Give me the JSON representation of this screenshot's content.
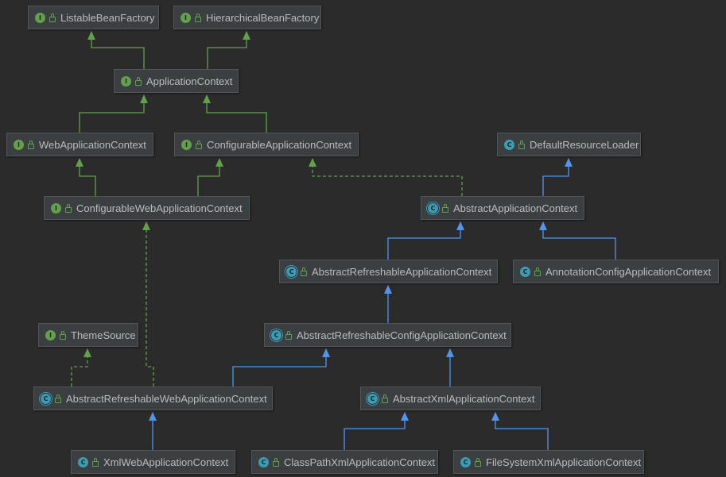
{
  "nodes": {
    "listable_bean_factory": {
      "label": "ListableBeanFactory",
      "kind": "interface",
      "badge": "I"
    },
    "hierarchical_bean_factory": {
      "label": "HierarchicalBeanFactory",
      "kind": "interface",
      "badge": "I"
    },
    "application_context": {
      "label": "ApplicationContext",
      "kind": "interface",
      "badge": "I"
    },
    "web_application_context": {
      "label": "WebApplicationContext",
      "kind": "interface",
      "badge": "I"
    },
    "configurable_application_context": {
      "label": "ConfigurableApplicationContext",
      "kind": "interface",
      "badge": "I"
    },
    "default_resource_loader": {
      "label": "DefaultResourceLoader",
      "kind": "class",
      "badge": "C"
    },
    "configurable_web_application_context": {
      "label": "ConfigurableWebApplicationContext",
      "kind": "interface",
      "badge": "I"
    },
    "abstract_application_context": {
      "label": "AbstractApplicationContext",
      "kind": "abstract",
      "badge": "C"
    },
    "abstract_refreshable_application_context": {
      "label": "AbstractRefreshableApplicationContext",
      "kind": "abstract",
      "badge": "C"
    },
    "annotation_config_application_context": {
      "label": "AnnotationConfigApplicationContext",
      "kind": "class",
      "badge": "C"
    },
    "theme_source": {
      "label": "ThemeSource",
      "kind": "interface",
      "badge": "I"
    },
    "abstract_refreshable_config_application_context": {
      "label": "AbstractRefreshableConfigApplicationContext",
      "kind": "abstract",
      "badge": "C"
    },
    "abstract_refreshable_web_application_context": {
      "label": "AbstractRefreshableWebApplicationContext",
      "kind": "abstract",
      "badge": "C"
    },
    "abstract_xml_application_context": {
      "label": "AbstractXmlApplicationContext",
      "kind": "abstract",
      "badge": "C"
    },
    "xml_web_application_context": {
      "label": "XmlWebApplicationContext",
      "kind": "class",
      "badge": "C"
    },
    "class_path_xml_application_context": {
      "label": "ClassPathXmlApplicationContext",
      "kind": "class",
      "badge": "C"
    },
    "file_system_xml_application_context": {
      "label": "FileSystemXmlApplicationContext",
      "kind": "class",
      "badge": "C"
    }
  },
  "edges": [
    {
      "from": "application_context",
      "to": "listable_bean_factory",
      "type": "interface-extends"
    },
    {
      "from": "application_context",
      "to": "hierarchical_bean_factory",
      "type": "interface-extends"
    },
    {
      "from": "web_application_context",
      "to": "application_context",
      "type": "interface-extends"
    },
    {
      "from": "configurable_application_context",
      "to": "application_context",
      "type": "interface-extends"
    },
    {
      "from": "configurable_web_application_context",
      "to": "web_application_context",
      "type": "interface-extends"
    },
    {
      "from": "configurable_web_application_context",
      "to": "configurable_application_context",
      "type": "interface-extends"
    },
    {
      "from": "abstract_application_context",
      "to": "configurable_application_context",
      "type": "implements"
    },
    {
      "from": "abstract_application_context",
      "to": "default_resource_loader",
      "type": "extends"
    },
    {
      "from": "abstract_refreshable_application_context",
      "to": "abstract_application_context",
      "type": "extends"
    },
    {
      "from": "annotation_config_application_context",
      "to": "abstract_application_context",
      "type": "extends"
    },
    {
      "from": "abstract_refreshable_config_application_context",
      "to": "abstract_refreshable_application_context",
      "type": "extends"
    },
    {
      "from": "abstract_refreshable_web_application_context",
      "to": "theme_source",
      "type": "implements"
    },
    {
      "from": "abstract_refreshable_web_application_context",
      "to": "configurable_web_application_context",
      "type": "implements"
    },
    {
      "from": "abstract_refreshable_web_application_context",
      "to": "abstract_refreshable_config_application_context",
      "type": "extends"
    },
    {
      "from": "abstract_xml_application_context",
      "to": "abstract_refreshable_config_application_context",
      "type": "extends"
    },
    {
      "from": "xml_web_application_context",
      "to": "abstract_refreshable_web_application_context",
      "type": "extends"
    },
    {
      "from": "class_path_xml_application_context",
      "to": "abstract_xml_application_context",
      "type": "extends"
    },
    {
      "from": "file_system_xml_application_context",
      "to": "abstract_xml_application_context",
      "type": "extends"
    }
  ],
  "colors": {
    "background": "#2b2b2b",
    "interface_edge": "#62a04d",
    "class_edge": "#5394ec",
    "interface_badge": "#62a04d",
    "class_badge": "#3d9bb5",
    "node_fill": "#3c3f41",
    "label_text": "#bbbbbb"
  }
}
